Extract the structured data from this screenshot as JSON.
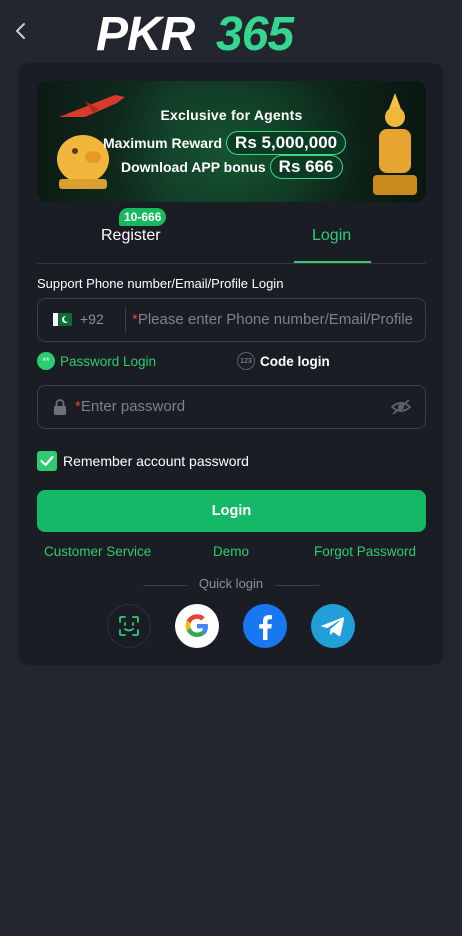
{
  "header": {
    "logo_text": "PKR365"
  },
  "banner": {
    "title": "Exclusive for Agents",
    "line1_label": "Maximum Reward",
    "line1_value": "Rs 5,000,000",
    "line2_label": "Download APP bonus",
    "line2_value": "Rs 666"
  },
  "tabs": {
    "register_label": "Register",
    "register_badge": "10-666",
    "login_label": "Login",
    "active": "Login"
  },
  "form": {
    "support_text": "Support Phone number/Email/Profile Login",
    "country_code": "+92",
    "phone_placeholder": "Please enter Phone number/Email/Profile",
    "required_mark": "*",
    "password_login_label": "Password Login",
    "password_login_icon_text": "**",
    "code_login_label": "Code login",
    "code_login_icon_text": "123",
    "password_placeholder": "Enter password",
    "remember_label": "Remember account password",
    "remember_checked": true,
    "login_button": "Login"
  },
  "links": {
    "customer_service": "Customer Service",
    "demo": "Demo",
    "forgot_password": "Forgot Password"
  },
  "quick_login": {
    "label": "Quick login",
    "providers": [
      "face-id",
      "google",
      "facebook",
      "telegram"
    ]
  },
  "colors": {
    "accent": "#2ecc71",
    "background": "#23252f",
    "card": "#1b1d24",
    "button": "#14b866"
  }
}
